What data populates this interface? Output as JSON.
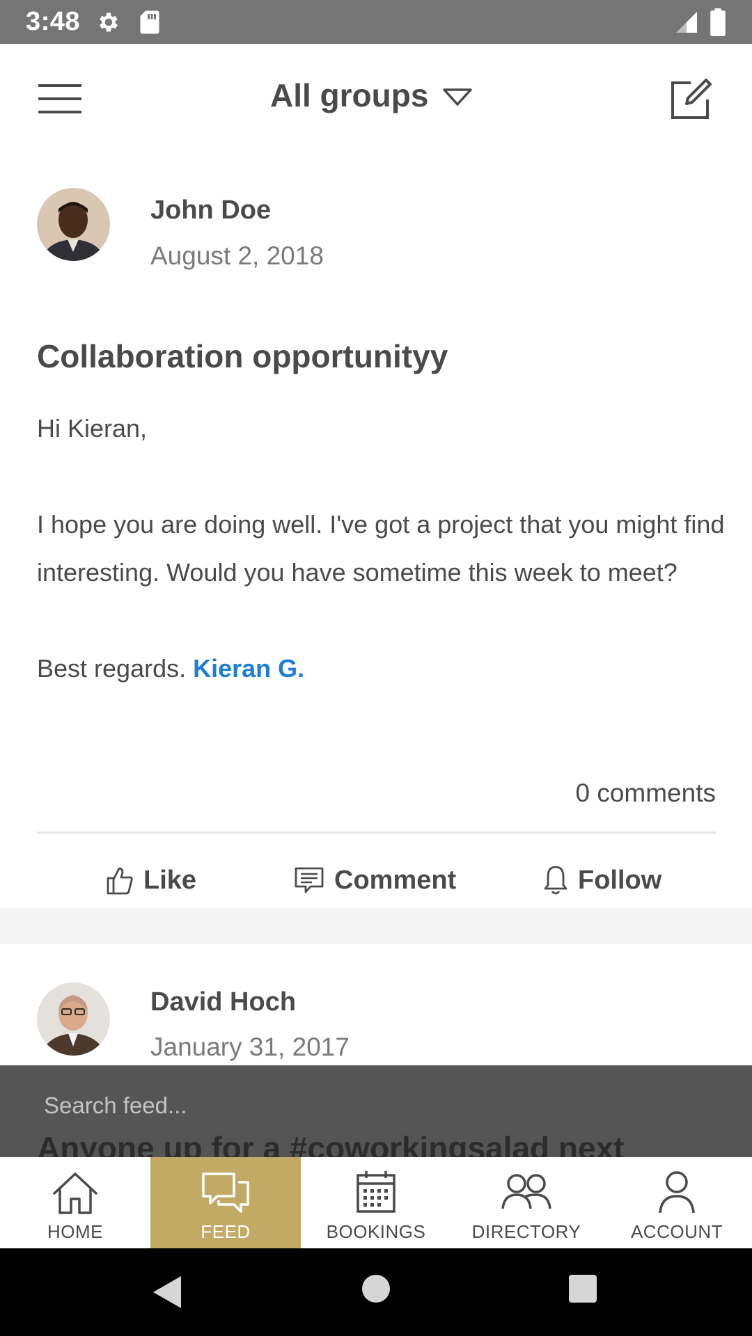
{
  "status_bar": {
    "time": "3:48"
  },
  "header": {
    "title": "All groups"
  },
  "posts": [
    {
      "author": "John Doe",
      "date": "August 2, 2018",
      "title": "Collaboration opportunityy",
      "greeting": "Hi Kieran,",
      "body": "I hope you are doing well. I've got a project that you might find interesting. Would you have sometime this week to meet?",
      "signoff": "Best regards.",
      "mention": "Kieran G.",
      "comments": "0 comments"
    },
    {
      "author": "David Hoch",
      "date": "January 31, 2017",
      "title_preview": "Anyone up for a #coworkingsalad next"
    }
  ],
  "actions": {
    "like": "Like",
    "comment": "Comment",
    "follow": "Follow"
  },
  "search": {
    "placeholder": "Search feed..."
  },
  "nav": {
    "items": [
      {
        "label": "HOME",
        "icon": "home-icon"
      },
      {
        "label": "FEED",
        "icon": "feed-icon",
        "active": true
      },
      {
        "label": "BOOKINGS",
        "icon": "calendar-icon"
      },
      {
        "label": "DIRECTORY",
        "icon": "people-icon"
      },
      {
        "label": "ACCOUNT",
        "icon": "person-icon"
      }
    ]
  },
  "colors": {
    "accent_gold": "#c3aa64",
    "mention_blue": "#1c7ed6",
    "text": "#4a4a4a",
    "status_bar": "#757575",
    "search_overlay": "#555555"
  }
}
